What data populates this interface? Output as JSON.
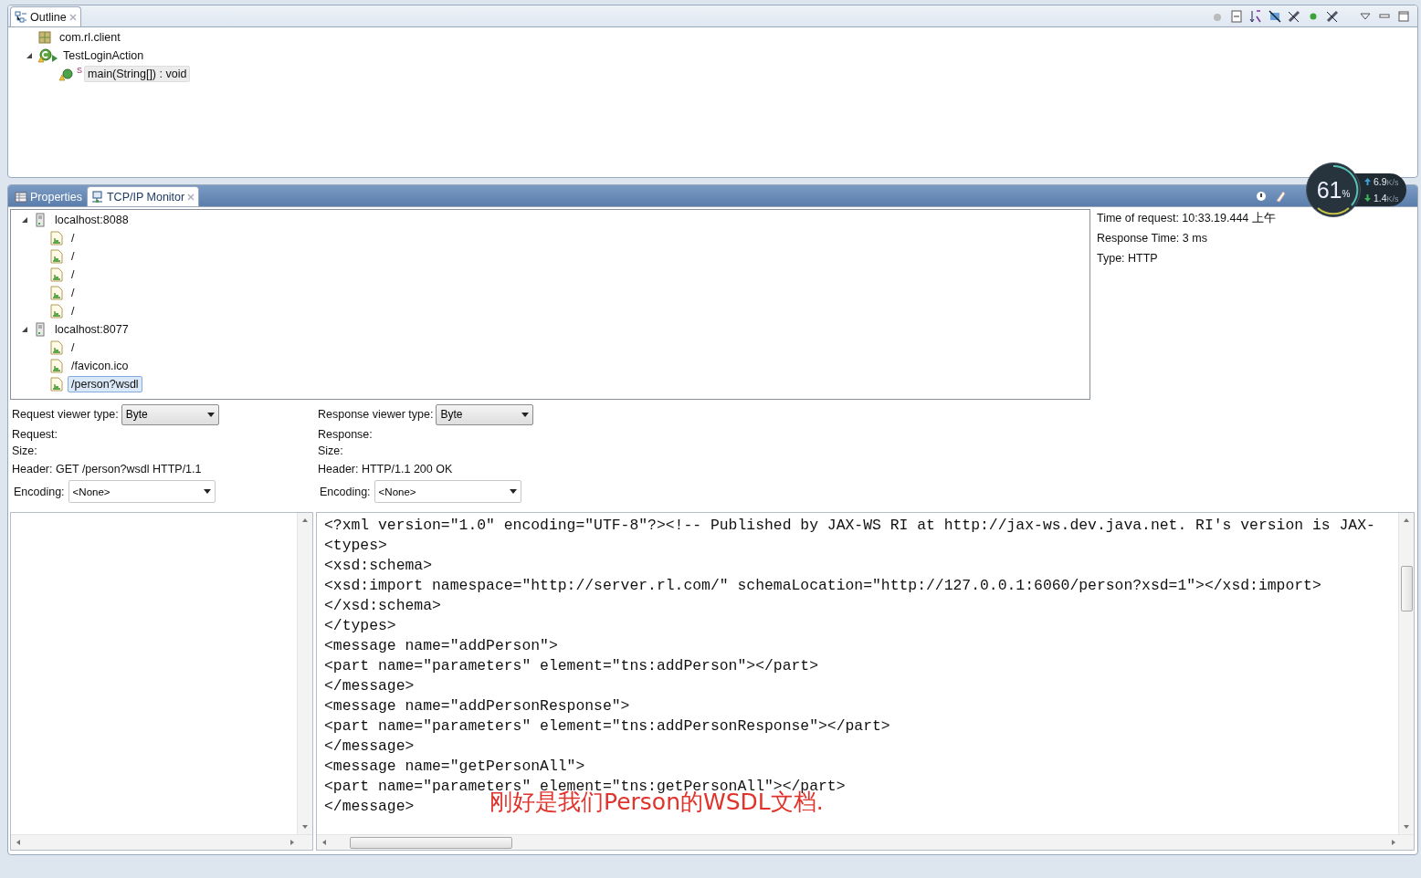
{
  "outline": {
    "tab": {
      "label": "Outline"
    },
    "tree": [
      {
        "label": "com.rl.client",
        "kind": "package"
      },
      {
        "label": "TestLoginAction",
        "kind": "class",
        "expanded": true,
        "children": [
          {
            "label": "main(String[]) : void",
            "kind": "method",
            "modifier": "S",
            "selected": true
          }
        ]
      }
    ]
  },
  "monitor": {
    "tabs": [
      {
        "label": "Properties",
        "selected": false
      },
      {
        "label": "TCP/IP Monitor",
        "selected": true
      }
    ],
    "tree": [
      {
        "label": "localhost:8088",
        "expanded": true,
        "children": [
          {
            "label": "/",
            "selected": false
          },
          {
            "label": "/",
            "selected": false
          },
          {
            "label": "/",
            "selected": false
          },
          {
            "label": "/",
            "selected": false
          },
          {
            "label": "/",
            "selected": false
          }
        ]
      },
      {
        "label": "localhost:8077",
        "expanded": true,
        "children": [
          {
            "label": "/",
            "selected": false
          },
          {
            "label": "/favicon.ico",
            "selected": false
          },
          {
            "label": "/person?wsdl",
            "selected": true
          }
        ]
      }
    ],
    "details": [
      "Time of request: 10:33.19.444 上午",
      "Response Time: 3 ms",
      "Type: HTTP"
    ],
    "request": {
      "viewer_label": "Request viewer type:",
      "viewer_type": "Byte",
      "title": "Request:",
      "size": "Size:",
      "header": "Header: GET /person?wsdl HTTP/1.1",
      "encoding_label": "Encoding:",
      "encoding": "<None>"
    },
    "response": {
      "viewer_label": "Response viewer type:",
      "viewer_type": "Byte",
      "title": "Response:",
      "size": "Size:",
      "header": "Header: HTTP/1.1 200 OK",
      "encoding_label": "Encoding:",
      "encoding": "<None>",
      "lines": [
        "<?xml version=\"1.0\" encoding=\"UTF-8\"?><!-- Published by JAX-WS RI at http://jax-ws.dev.java.net. RI's version is JAX-",
        "<types>",
        "<xsd:schema>",
        "<xsd:import namespace=\"http://server.rl.com/\" schemaLocation=\"http://127.0.0.1:6060/person?xsd=1\"></xsd:import>",
        "</xsd:schema>",
        "</types>",
        "<message name=\"addPerson\">",
        "<part name=\"parameters\" element=\"tns:addPerson\"></part>",
        "</message>",
        "<message name=\"addPersonResponse\">",
        "<part name=\"parameters\" element=\"tns:addPersonResponse\"></part>",
        "</message>",
        "<message name=\"getPersonAll\">",
        "<part name=\"parameters\" element=\"tns:getPersonAll\"></part>",
        "</message>"
      ],
      "annotation": "刚好是我们Person的WSDL文档."
    }
  },
  "speed_widget": {
    "percent": "61",
    "percent_unit": "%",
    "upload": "6.9",
    "upload_unit": "K/s",
    "download": "1.4",
    "download_unit": "K/s"
  }
}
